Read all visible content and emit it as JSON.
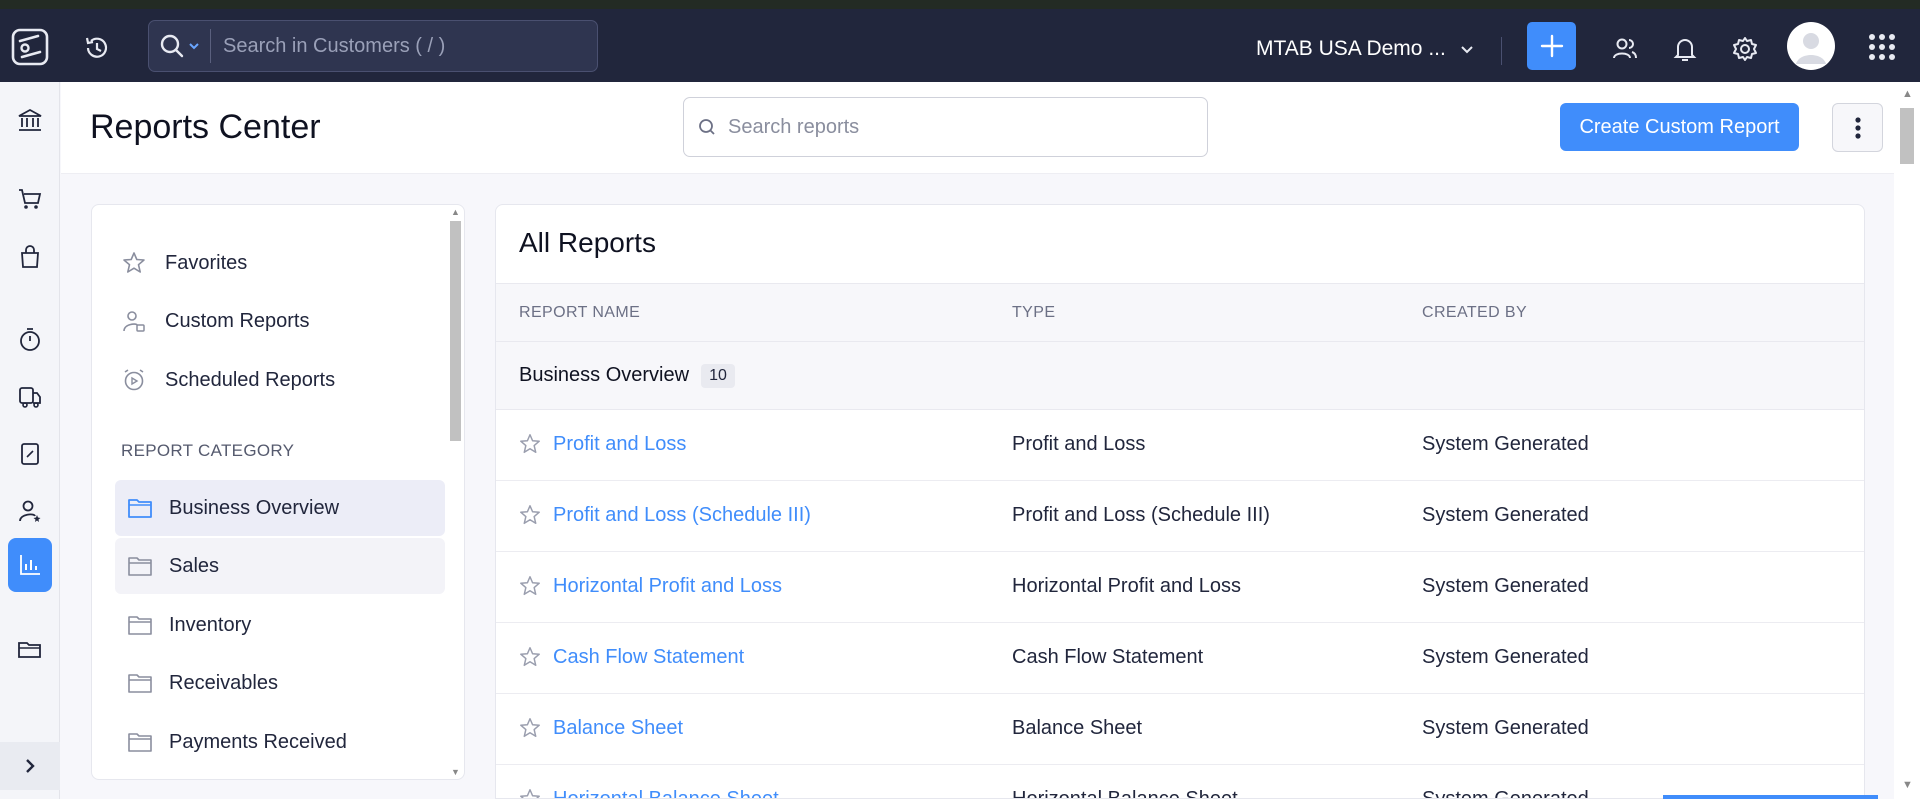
{
  "header": {
    "search_placeholder": "Search in Customers ( / )",
    "org_name": "MTAB USA Demo ...",
    "accent_color": "#408dfb",
    "bg_color": "#21263c"
  },
  "rail": {
    "items": [
      "banking-icon",
      "sales-cart-icon",
      "purchases-bag-icon",
      "time-tracking-icon",
      "eway-bill-icon",
      "accountant-icon",
      "contacts-icon",
      "reports-icon",
      "documents-icon"
    ],
    "active": "reports-icon"
  },
  "page": {
    "title": "Reports Center",
    "search_placeholder": "Search reports",
    "create_button": "Create Custom Report"
  },
  "sidebar": {
    "quick_links": [
      {
        "label": "Favorites",
        "icon": "star-icon"
      },
      {
        "label": "Custom Reports",
        "icon": "custom-report-user-icon"
      },
      {
        "label": "Scheduled Reports",
        "icon": "scheduled-clock-icon"
      }
    ],
    "category_heading": "REPORT CATEGORY",
    "categories": [
      {
        "label": "Business Overview",
        "selected": true
      },
      {
        "label": "Sales",
        "hover": true
      },
      {
        "label": "Inventory"
      },
      {
        "label": "Receivables"
      },
      {
        "label": "Payments Received"
      }
    ]
  },
  "reports": {
    "title": "All Reports",
    "columns": [
      "REPORT NAME",
      "TYPE",
      "CREATED BY"
    ],
    "group": {
      "name": "Business Overview",
      "count": "10"
    },
    "rows": [
      {
        "name": "Profit and Loss",
        "type": "Profit and Loss",
        "created_by": "System Generated"
      },
      {
        "name": "Profit and Loss (Schedule III)",
        "type": "Profit and Loss (Schedule III)",
        "created_by": "System Generated"
      },
      {
        "name": "Horizontal Profit and Loss",
        "type": "Horizontal Profit and Loss",
        "created_by": "System Generated"
      },
      {
        "name": "Cash Flow Statement",
        "type": "Cash Flow Statement",
        "created_by": "System Generated"
      },
      {
        "name": "Balance Sheet",
        "type": "Balance Sheet",
        "created_by": "System Generated"
      },
      {
        "name": "Horizontal Balance Sheet",
        "type": "Horizontal Balance Sheet",
        "created_by": "System Generated"
      }
    ]
  }
}
